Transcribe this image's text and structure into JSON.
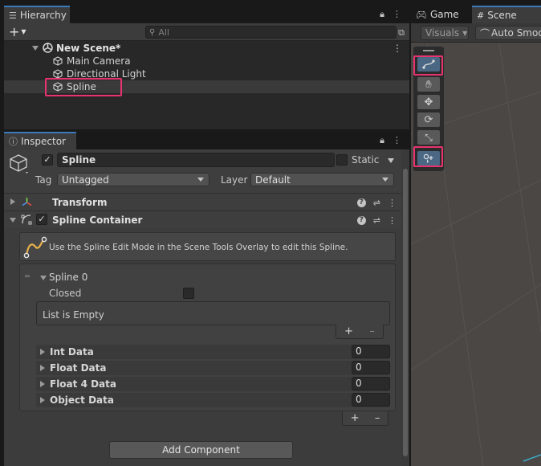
{
  "hierarchy": {
    "tab_label": "Hierarchy",
    "add_label": "+",
    "search_placeholder": "All",
    "scene_name": "New Scene*",
    "items": [
      {
        "label": "Main Camera"
      },
      {
        "label": "Directional Light"
      },
      {
        "label": "Spline"
      }
    ]
  },
  "inspector": {
    "tab_label": "Inspector",
    "object_name": "Spline",
    "static_label": "Static",
    "tag_label": "Tag",
    "tag_value": "Untagged",
    "layer_label": "Layer",
    "layer_value": "Default",
    "components": [
      {
        "title": "Transform"
      },
      {
        "title": "Spline Container"
      }
    ],
    "help_text": "Use the Spline Edit Mode in the Scene Tools Overlay to edit this Spline.",
    "spline": {
      "title": "Spline 0",
      "closed_label": "Closed",
      "list_empty": "List is Empty",
      "plus": "+",
      "minus": "–",
      "data_rows": [
        {
          "label": "Int Data",
          "value": "0"
        },
        {
          "label": "Float Data",
          "value": "0"
        },
        {
          "label": "Float 4 Data",
          "value": "0"
        },
        {
          "label": "Object Data",
          "value": "0"
        }
      ]
    },
    "add_component": "Add Component"
  },
  "scene": {
    "game_tab": "Game",
    "scene_tab": "Scene",
    "visuals_label": "Visuals",
    "smooth_label": "Auto Smoo",
    "tools": [
      "spline-edit-icon",
      "hand-icon",
      "move-icon",
      "rotate-icon",
      "scale-icon",
      "add-knot-icon"
    ]
  },
  "colors": {
    "highlight": "#e8336e",
    "accent": "#3a79bb",
    "active_tool": "#4a6784"
  }
}
